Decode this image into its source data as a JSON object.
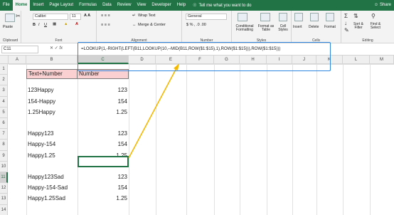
{
  "menu": {
    "tabs": [
      "File",
      "Home",
      "Insert",
      "Page Layout",
      "Formulas",
      "Data",
      "Review",
      "View",
      "Developer",
      "Help"
    ],
    "active_tab": "Home",
    "tell": "Tell me what you want to do",
    "share": "Share"
  },
  "ribbon": {
    "paste": "Paste",
    "clipboard": "Clipboard",
    "font_name": "Calibri",
    "font_size": "11",
    "font_group": "Font",
    "wrap_text": "Wrap Text",
    "merge_center": "Merge & Center",
    "alignment": "Alignment",
    "number_format": "General",
    "number": "Number",
    "conditional_formatting": "Conditional Formatting",
    "format_as_table": "Format as Table",
    "cell_styles": "Cell Styles",
    "styles": "Styles",
    "insert": "Insert",
    "delete": "Delete",
    "format": "Format",
    "cells": "Cells",
    "sort_filter": "Sort & Filter",
    "find_select": "Find & Select",
    "editing": "Editing"
  },
  "formula_bar": {
    "name_box": "C11",
    "fx": "fx",
    "formula": "=LOOKUP(1,-RIGHT(LEFT(B11,LOOKUP(10,--MID(B11,ROW($1:$15),1),ROW($1:$15))),ROW($1:$15)))"
  },
  "columns": [
    "A",
    "B",
    "C",
    "D",
    "E",
    "F",
    "G",
    "H",
    "I",
    "J",
    "K",
    "L",
    "M"
  ],
  "selected_column": "C",
  "rows": [
    "1",
    "2",
    "3",
    "4",
    "5",
    "6",
    "7",
    "8",
    "9",
    "10",
    "11",
    "12",
    "13",
    "14"
  ],
  "selected_row": "11",
  "headers": {
    "b": "Text+Number",
    "c": "Number"
  },
  "data": [
    {
      "row": 3,
      "b": "123Happy",
      "c": "123"
    },
    {
      "row": 4,
      "b": "154-Happy",
      "c": "154"
    },
    {
      "row": 5,
      "b": "1.25Happy",
      "c": "1.25"
    },
    {
      "row": 7,
      "b": "Happy123",
      "c": "123"
    },
    {
      "row": 8,
      "b": "Happy-154",
      "c": "154"
    },
    {
      "row": 9,
      "b": "Happy1.25",
      "c": "1.25"
    },
    {
      "row": 11,
      "b": "Happy123Sad",
      "c": "123"
    },
    {
      "row": 12,
      "b": "Happy-154-Sad",
      "c": "154"
    },
    {
      "row": 13,
      "b": "Happy1.25Sad",
      "c": "1.25"
    }
  ],
  "colors": {
    "excel_green": "#217346",
    "header_fill": "#fbd0d0",
    "highlight": "#2e86de",
    "arrow": "#f5b800"
  }
}
